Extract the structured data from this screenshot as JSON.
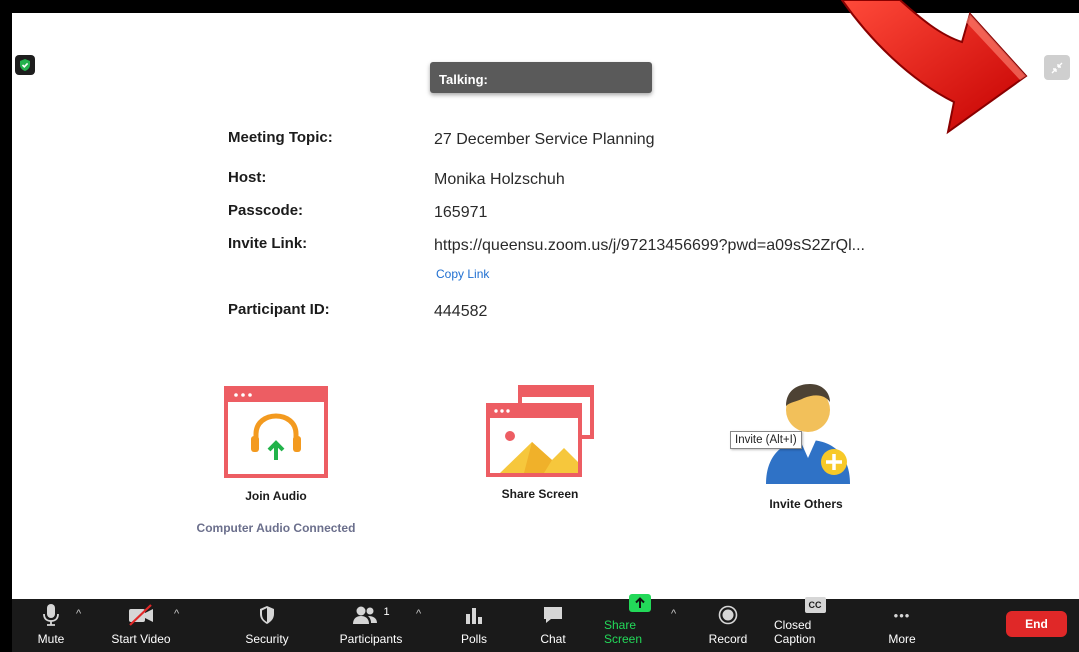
{
  "talking_label": "Talking:",
  "meeting": {
    "topic_label": "Meeting Topic:",
    "topic_value": "27 December Service Planning",
    "host_label": "Host:",
    "host_value": "Monika Holzschuh",
    "passcode_label": "Passcode:",
    "passcode_value": "165971",
    "invite_label": "Invite Link:",
    "invite_value": "https://queensu.zoom.us/j/97213456699?pwd=a09sS2ZrQl...",
    "copy_link_label": "Copy Link",
    "participant_label": "Participant ID:",
    "participant_value": "444582"
  },
  "actions": {
    "join_audio": "Join Audio",
    "audio_status": "Computer Audio Connected",
    "share_screen": "Share Screen",
    "invite_others": "Invite Others",
    "invite_tooltip": "Invite (Alt+I)"
  },
  "toolbar": {
    "mute": "Mute",
    "start_video": "Start Video",
    "security": "Security",
    "participants": "Participants",
    "participants_count": "1",
    "polls": "Polls",
    "chat": "Chat",
    "share_screen": "Share Screen",
    "record": "Record",
    "closed_caption": "Closed Caption",
    "cc_glyph": "CC",
    "more": "More",
    "more_glyph": "•••",
    "end": "End"
  },
  "colors": {
    "accent_green": "#23d959",
    "end_red": "#e02828",
    "link_blue": "#1f6fd1",
    "annotation_red": "#e8100f"
  }
}
